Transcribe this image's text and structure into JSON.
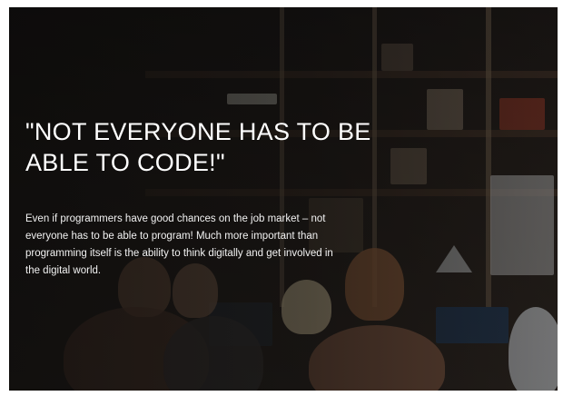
{
  "hero": {
    "headline": "\"NOT EVERYONE HAS TO BE ABLE TO CODE!\"",
    "body": "Even if programmers have good chances on the job market – not everyone has to be able to program! Much more important than programming itself is the ability to think digitally and get involved in the digital world."
  },
  "colors": {
    "overlay": "#080808",
    "text": "#ffffff",
    "shelf": "#3a2c22"
  }
}
